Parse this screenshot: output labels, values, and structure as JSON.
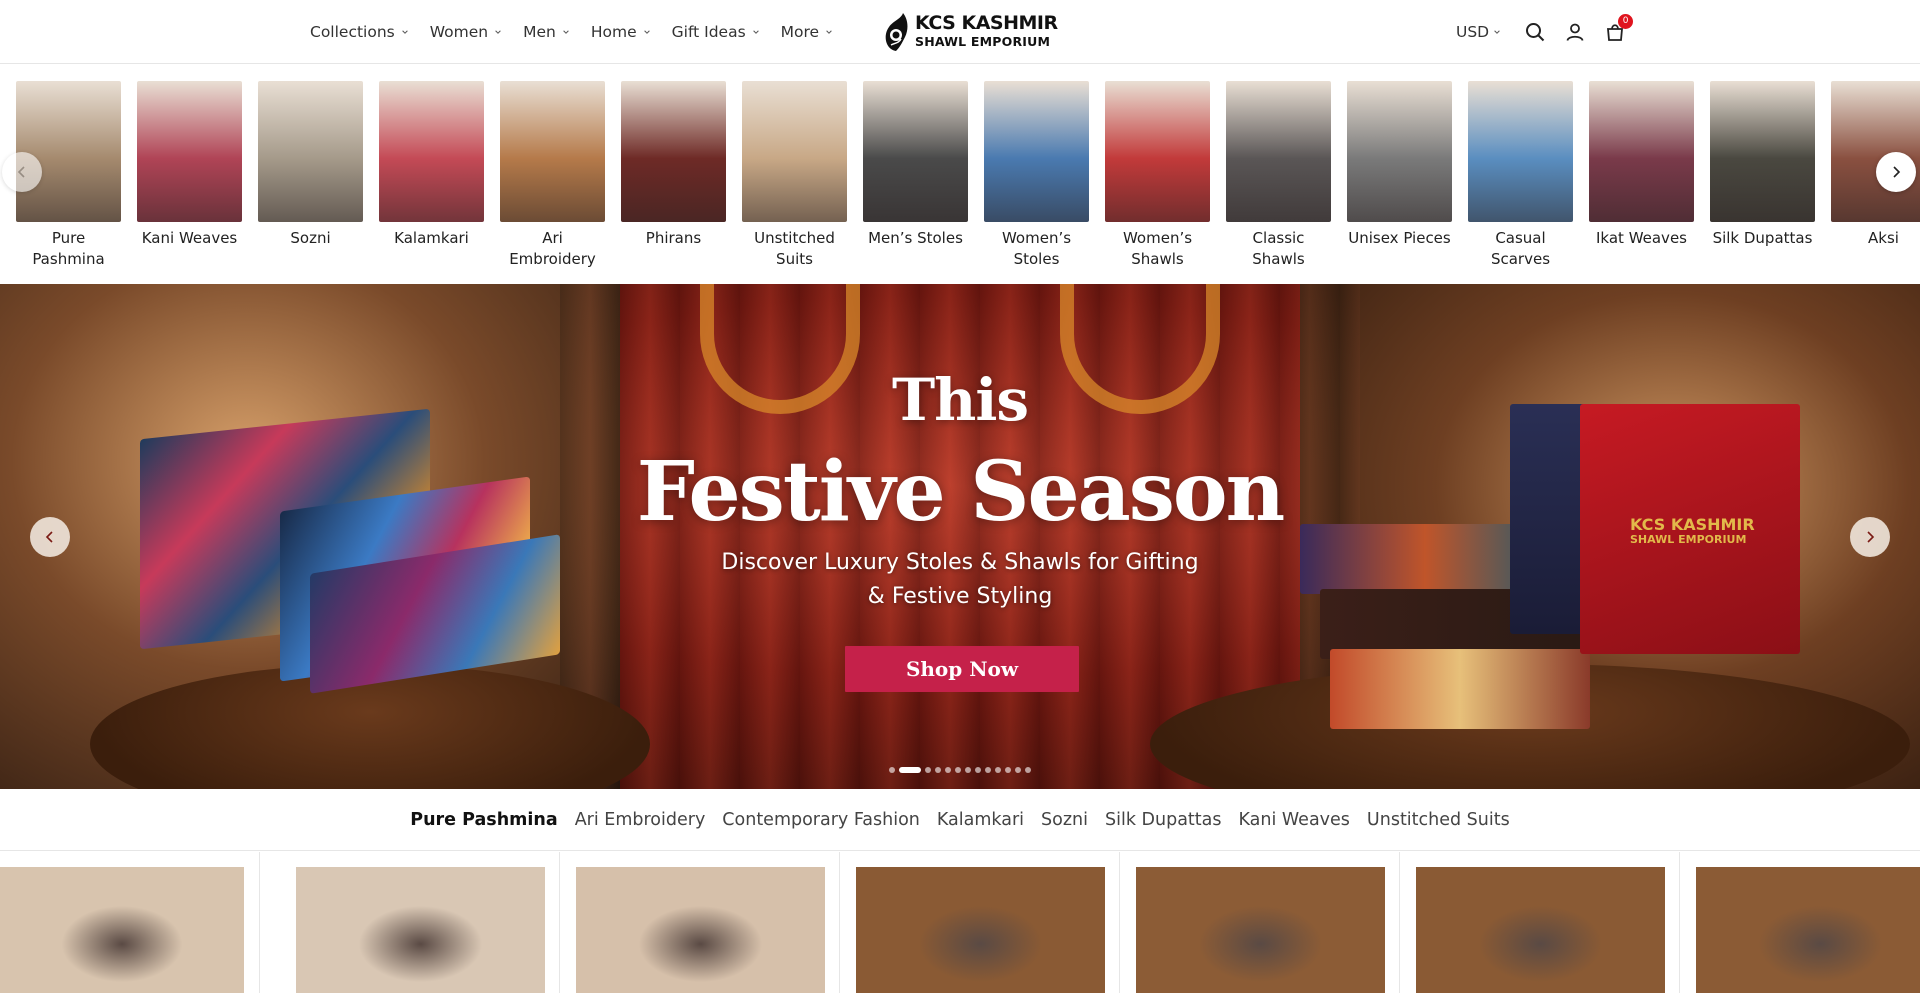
{
  "header": {
    "nav": [
      "Collections",
      "Women",
      "Men",
      "Home",
      "Gift Ideas",
      "More"
    ],
    "logo_line1": "KCS KASHMIR",
    "logo_line2": "SHAWL EMPORIUM",
    "currency": "USD",
    "cart_count": "0"
  },
  "categories": [
    {
      "label": "Pure Pashmina",
      "color": "#a58a6e"
    },
    {
      "label": "Kani Weaves",
      "color": "#b04456"
    },
    {
      "label": "Sozni",
      "color": "#a59a8a"
    },
    {
      "label": "Kalamkari",
      "color": "#c44a56"
    },
    {
      "label": "Ari Embroidery",
      "color": "#b57a4a"
    },
    {
      "label": "Phirans",
      "color": "#6e2a26"
    },
    {
      "label": "Unstitched Suits",
      "color": "#c8a886"
    },
    {
      "label": "Men’s Stoles",
      "color": "#4a4a4a"
    },
    {
      "label": "Women’s Stoles",
      "color": "#4a7ab0"
    },
    {
      "label": "Women’s Shawls",
      "color": "#c23a3a"
    },
    {
      "label": "Classic Shawls",
      "color": "#5a5656"
    },
    {
      "label": "Unisex Pieces",
      "color": "#7a7a7a"
    },
    {
      "label": "Casual Scarves",
      "color": "#5a8ec0"
    },
    {
      "label": "Ikat Weaves",
      "color": "#7a3a4a"
    },
    {
      "label": "Silk Dupattas",
      "color": "#4a4840"
    },
    {
      "label": "Aksi",
      "color": "#8a5040"
    }
  ],
  "hero": {
    "line1": "This",
    "line2": "Festive Season",
    "sub1": "Discover Luxury Stoles & Shawls for Gifting",
    "sub2": "& Festive Styling",
    "cta": "Shop Now",
    "box_brand1": "KCS KASHMIR",
    "box_brand2": "SHAWL EMPORIUM",
    "slide_count": 13,
    "active_slide": 2
  },
  "tabs": [
    "Pure Pashmina",
    "Ari Embroidery",
    "Contemporary Fashion",
    "Kalamkari",
    "Sozni",
    "Silk Dupattas",
    "Kani Weaves",
    "Unstitched Suits"
  ],
  "active_tab": 0,
  "products": [
    {
      "bg": "#d8c4ae"
    },
    {
      "bg": "#d9c7b4"
    },
    {
      "bg": "#d6c0aa"
    },
    {
      "bg": "#8a5a34"
    },
    {
      "bg": "#8c5c36"
    },
    {
      "bg": "#8a5a34"
    },
    {
      "bg": "#8b5b35"
    }
  ]
}
